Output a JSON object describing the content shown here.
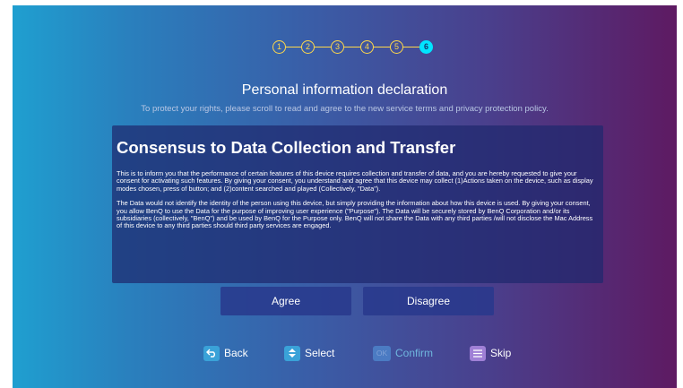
{
  "stepper": {
    "steps": [
      "1",
      "2",
      "3",
      "4",
      "5",
      "6"
    ],
    "active_step": "6"
  },
  "header": {
    "title": "Personal information declaration",
    "subtitle": "To protect your rights, please scroll to read and agree to the new service terms and privacy protection policy."
  },
  "panel": {
    "heading": "Consensus to Data Collection and Transfer",
    "paragraph1": "This is to inform you that the performance of certain features of this device requires collection and transfer of data, and you are hereby requested to give your consent for activating such features. By giving your consent, you understand and agree that this device may collect (1)Actions taken on the device, such as display modes chosen, press of button; and (2)content searched and played (Collectively, \"Data\").",
    "paragraph2": "The Data would not identify the identity of the person using this device, but simply providing the information about how this device is used. By giving your consent, you allow BenQ to use the Data for the purpose of improving user experience (\"Purpose\"). The Data will be securely stored by BenQ Corporation and/or its subsidiaries (collectively, \"BenQ\") and be used by BenQ for the Purpose only. BenQ will not share the Data with any third parties /will not disclose the Mac Address of this device to any third parties should third party services are engaged."
  },
  "buttons": {
    "agree": "Agree",
    "disagree": "Disagree"
  },
  "nav": {
    "back": "Back",
    "select": "Select",
    "confirm": "Confirm",
    "ok_key": "OK",
    "skip": "Skip"
  },
  "icons": {
    "back": "back-arrow-icon",
    "select": "up-down-icon",
    "skip": "menu-lines-icon"
  },
  "colors": {
    "step_ring": "#ffd84a",
    "step_active": "#00e5ff",
    "gradient_left": "#1f9fd0",
    "gradient_right": "#5e1a62"
  }
}
